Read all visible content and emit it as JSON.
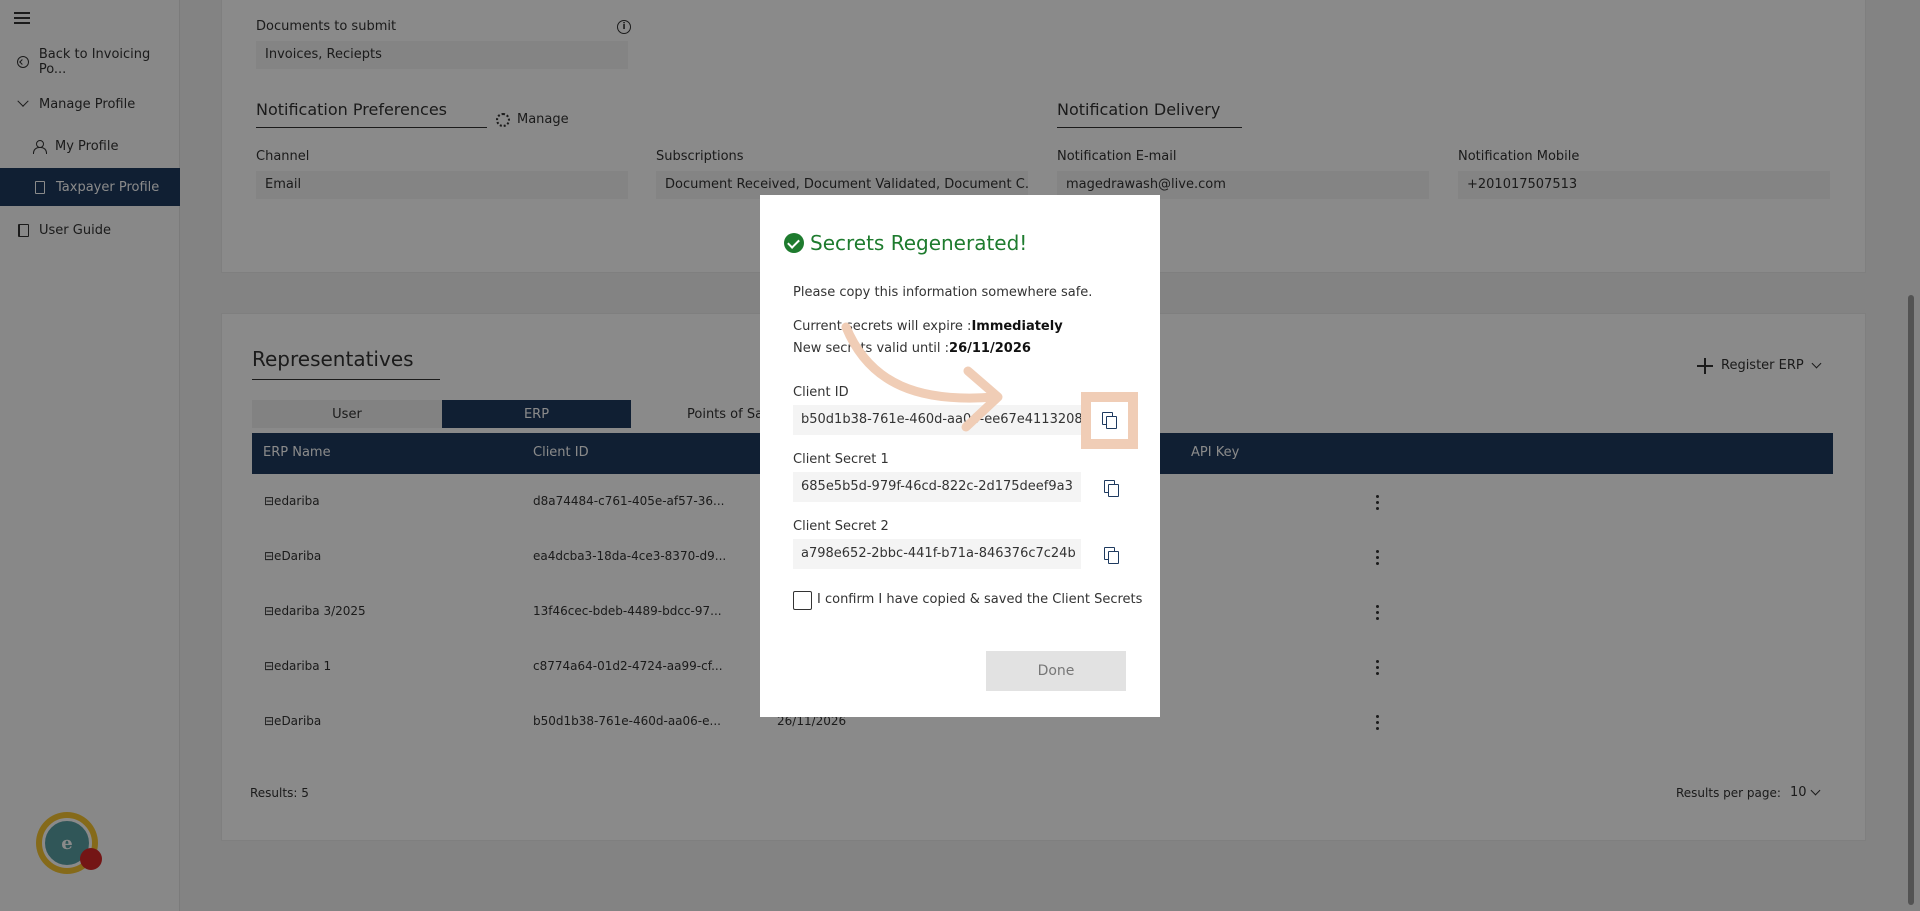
{
  "sidebar": {
    "items": [
      {
        "label": "Back to Invoicing Po..."
      },
      {
        "label": "Manage Profile"
      },
      {
        "label": "My Profile"
      },
      {
        "label": "Taxpayer Profile"
      },
      {
        "label": "User Guide"
      }
    ]
  },
  "profile": {
    "documents_label": "Documents to submit",
    "documents_value": "Invoices, Reciepts",
    "notif_prefs_title": "Notification Preferences",
    "manage_label": "Manage",
    "notif_delivery_title": "Notification Delivery",
    "channel_label": "Channel",
    "channel_value": "Email",
    "subscriptions_label": "Subscriptions",
    "subscriptions_value": "Document Received, Document Validated, Document C...",
    "email_label": "Notification E-mail",
    "email_value": "magedrawash@live.com",
    "mobile_label": "Notification Mobile",
    "mobile_value": "+201017507513"
  },
  "representatives": {
    "title": "Representatives",
    "register_label": "Register ERP",
    "tabs": [
      {
        "label": "User"
      },
      {
        "label": "ERP"
      },
      {
        "label": "Points of Sa"
      }
    ],
    "columns": [
      "ERP Name",
      "Client ID",
      "API Key"
    ],
    "rows": [
      {
        "name": "⊟edariba",
        "client_id": "d8a74484-c761-405e-af57-36...",
        "date": ""
      },
      {
        "name": "⊟eDariba",
        "client_id": "ea4dcba3-18da-4ce3-8370-d9...",
        "date": ""
      },
      {
        "name": "⊟edariba 3/2025",
        "client_id": "13f46cec-bdeb-4489-bdcc-97...",
        "date": ""
      },
      {
        "name": "⊟edariba 1",
        "client_id": "c8774a64-01d2-4724-aa99-cf...",
        "date": ""
      },
      {
        "name": "⊟eDariba",
        "client_id": "b50d1b38-761e-460d-aa06-e...",
        "date": "26/11/2026"
      }
    ],
    "results_label": "Results: 5",
    "per_page_label": "Results per page:",
    "per_page_value": "10"
  },
  "modal": {
    "title": "Secrets Regenerated!",
    "line1": "Please copy this information somewhere safe.",
    "expire_prefix": "Current secrets will expire :",
    "expire_value": "Immediately",
    "valid_prefix": "New secrets valid until :",
    "valid_value": "26/11/2026",
    "client_id_label": "Client ID",
    "client_id_value": "b50d1b38-761e-460d-aa06-ee67e4113208",
    "secret1_label": "Client Secret 1",
    "secret1_value": "685e5b5d-979f-46cd-822c-2d175deef9a3",
    "secret2_label": "Client Secret 2",
    "secret2_value": "a798e652-2bbc-441f-b71a-846376c7c24b",
    "confirm_label": "I confirm I have copied & saved the Client Secrets",
    "done_label": "Done"
  },
  "colors": {
    "primary": "#1e3a5f",
    "success": "#1e7b2e",
    "highlight": "#f0cdb6",
    "logo_yellow": "#f6c531",
    "logo_teal": "#5aa0a3",
    "logo_red": "#d62828"
  }
}
